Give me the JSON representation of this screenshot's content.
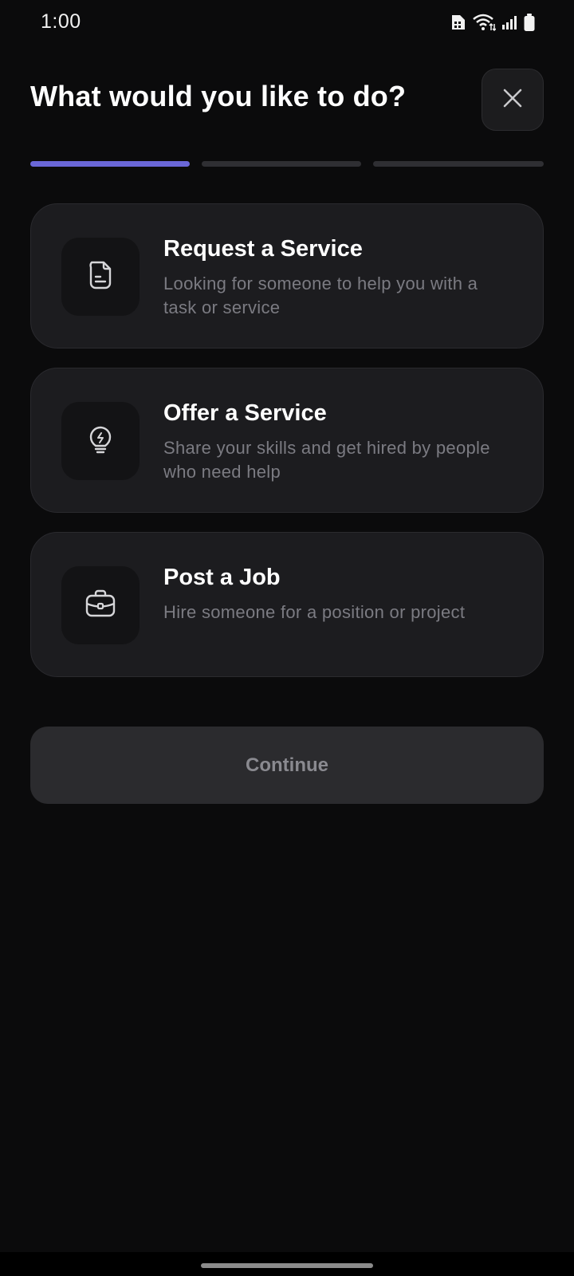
{
  "status_bar": {
    "time": "1:00",
    "icons": [
      "sim-icon",
      "wifi-icon",
      "signal-icon",
      "battery-icon"
    ]
  },
  "header": {
    "title": "What would you like to do?",
    "close_icon": "close-icon"
  },
  "progress": {
    "total_steps": 3,
    "current_step": 1,
    "active_color": "#6a67d8",
    "inactive_color": "#2f2f33"
  },
  "options": [
    {
      "title": "Request a Service",
      "description": "Looking for someone to help you with a task or service",
      "icon": "document-icon"
    },
    {
      "title": "Offer a Service",
      "description": "Share your skills and get hired by people who need help",
      "icon": "lightbulb-icon"
    },
    {
      "title": "Post a Job",
      "description": "Hire someone for a position or project",
      "icon": "briefcase-icon"
    }
  ],
  "continue_button": {
    "label": "Continue",
    "enabled": false
  },
  "colors": {
    "background": "#0b0b0c",
    "card": "#1c1c1f",
    "accent": "#6a67d8",
    "muted_text": "#7b7b82"
  }
}
